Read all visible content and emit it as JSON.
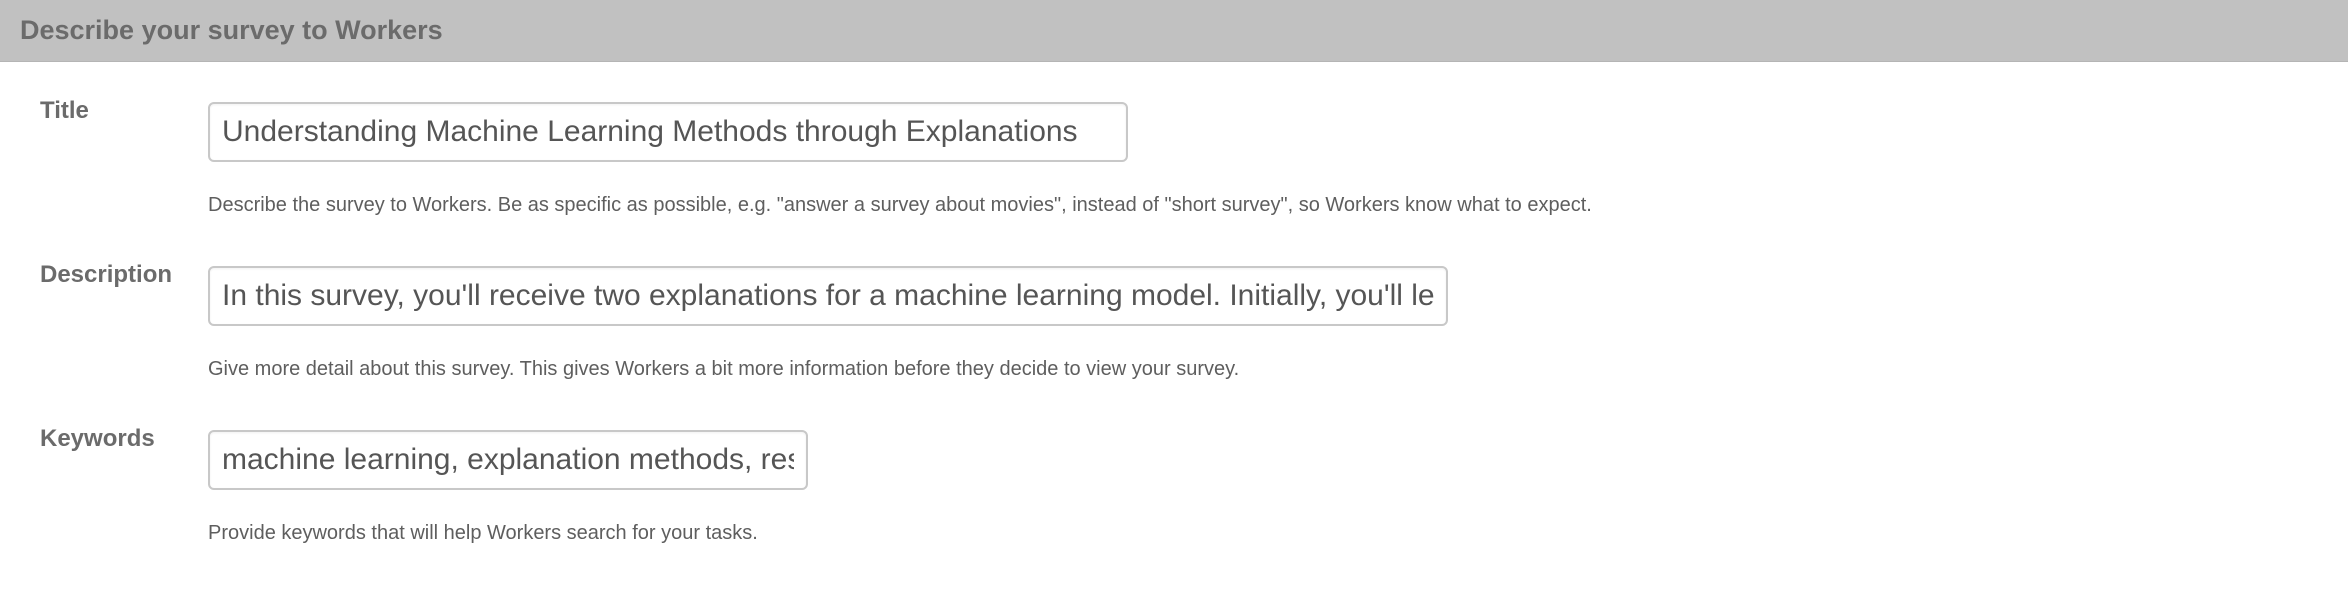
{
  "header": {
    "title": "Describe your survey to Workers"
  },
  "fields": {
    "title": {
      "label": "Title",
      "value": "Understanding Machine Learning Methods through Explanations",
      "help": "Describe the survey to Workers. Be as specific as possible, e.g. \"answer a survey about movies\", instead of \"short survey\", so Workers know what to expect."
    },
    "description": {
      "label": "Description",
      "value": "In this survey, you'll receive two explanations for a machine learning model. Initially, you'll learn how",
      "help": "Give more detail about this survey. This gives Workers a bit more information before they decide to view your survey."
    },
    "keywords": {
      "label": "Keywords",
      "value": "machine learning, explanation methods, research",
      "help": "Provide keywords that will help Workers search for your tasks."
    }
  },
  "colors": {
    "header_bg": "#c1c1c1",
    "header_text": "#6b6b6b",
    "label_text": "#6b6b6b",
    "help_text": "#5e5e5e",
    "input_border": "#c8c8c8"
  }
}
